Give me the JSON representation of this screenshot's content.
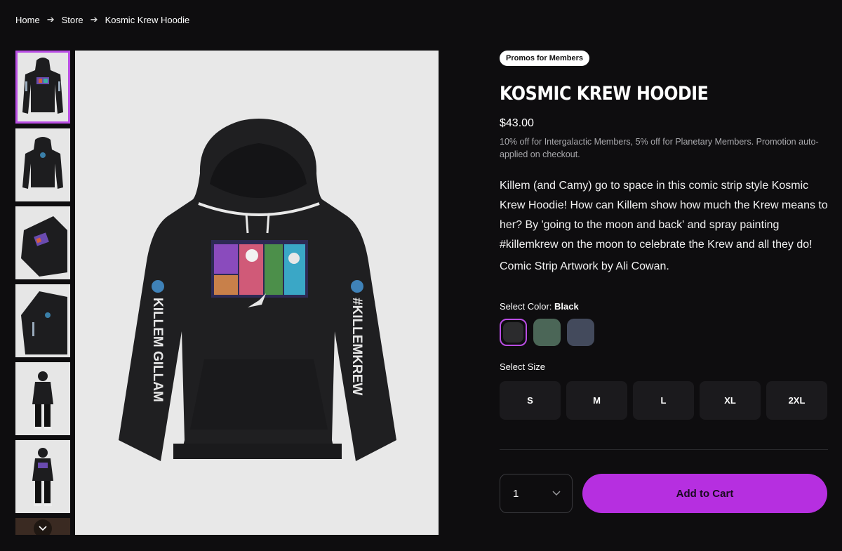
{
  "breadcrumb": [
    "Home",
    "Store",
    "Kosmic Krew Hoodie"
  ],
  "product": {
    "badge": "Promos for Members",
    "title": "KOSMIC KREW HOODIE",
    "price": "$43.00",
    "promo_note": "10% off for Intergalactic Members, 5% off for Planetary Members. Promotion auto-applied on checkout.",
    "description": "Killem (and Camy) go to space in this comic strip style Kosmic Krew Hoodie! How can Killem show how much the Krew means to her? By 'going to the moon and back' and spray painting #killemkrew on the moon to celebrate the Krew and all they do!",
    "credit": "Comic Strip Artwork by Ali Cowan.",
    "sleeve_left": "KILLEM GILLAM",
    "sleeve_right": "#KILLEMKREW"
  },
  "color": {
    "label": "Select Color:",
    "selected": "Black",
    "options": [
      {
        "name": "Black",
        "hex": "#2b2b2d"
      },
      {
        "name": "Green",
        "hex": "#4b6657"
      },
      {
        "name": "Navy",
        "hex": "#434a5c"
      }
    ]
  },
  "size": {
    "label": "Select Size",
    "options": [
      "S",
      "M",
      "L",
      "XL",
      "2XL"
    ]
  },
  "cart": {
    "quantity": "1",
    "add_label": "Add to Cart"
  },
  "colors": {
    "accent": "#b62fe0",
    "background": "#0e0d0f"
  }
}
